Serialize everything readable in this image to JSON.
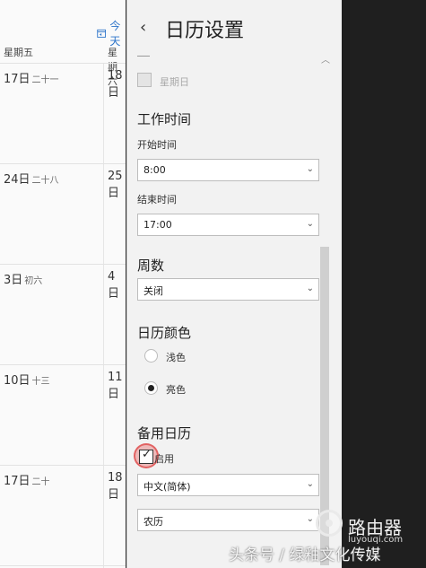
{
  "window": {
    "accent_color": "#2b73c9"
  },
  "calendar": {
    "today_label": "今天",
    "day_headers": [
      "星期五",
      "星期六"
    ],
    "weeks": [
      {
        "date": "17日",
        "lunar": "二十一",
        "next": "18日"
      },
      {
        "date": "24日",
        "lunar": "二十八",
        "next": "25日"
      },
      {
        "date": "3日",
        "lunar": "初六",
        "next": "4日"
      },
      {
        "date": "10日",
        "lunar": "十三",
        "next": "11日"
      },
      {
        "date": "17日",
        "lunar": "二十",
        "next": "18日"
      }
    ]
  },
  "settings": {
    "title": "日历设置",
    "back_icon": "chevron-left-icon",
    "sunday_label": "星期日",
    "work_time": {
      "heading": "工作时间",
      "start_label": "开始时间",
      "start_value": "8:00",
      "end_label": "结束时间",
      "end_value": "17:00"
    },
    "week_numbers": {
      "heading": "周数",
      "value": "关闭"
    },
    "calendar_color": {
      "heading": "日历颜色",
      "options": [
        "浅色",
        "亮色"
      ],
      "selected": "亮色"
    },
    "alternate_calendar": {
      "heading": "备用日历",
      "enable_label": "启用",
      "enabled": true,
      "language_value": "中文(简体)",
      "type_value": "农历"
    }
  },
  "watermark": {
    "brand": "路由器",
    "url": "luyouqi.com",
    "caption": "头条号 / 绿釉文化传媒"
  }
}
